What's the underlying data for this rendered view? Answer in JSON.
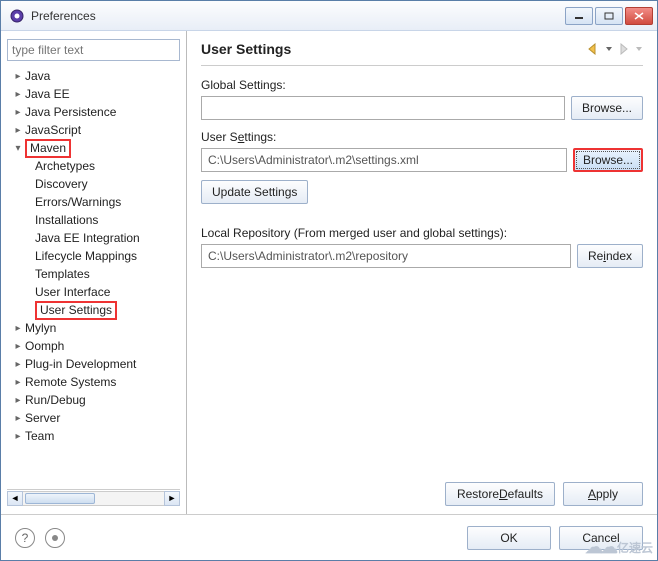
{
  "window": {
    "title": "Preferences"
  },
  "filter": {
    "placeholder": "type filter text"
  },
  "tree": {
    "items": [
      {
        "label": "Java",
        "level": 1,
        "expandable": true,
        "expanded": false
      },
      {
        "label": "Java EE",
        "level": 1,
        "expandable": true,
        "expanded": false
      },
      {
        "label": "Java Persistence",
        "level": 1,
        "expandable": true,
        "expanded": false
      },
      {
        "label": "JavaScript",
        "level": 1,
        "expandable": true,
        "expanded": false
      },
      {
        "label": "Maven",
        "level": 1,
        "expandable": true,
        "expanded": true,
        "highlight": true
      },
      {
        "label": "Archetypes",
        "level": 2,
        "expandable": false
      },
      {
        "label": "Discovery",
        "level": 2,
        "expandable": false
      },
      {
        "label": "Errors/Warnings",
        "level": 2,
        "expandable": false
      },
      {
        "label": "Installations",
        "level": 2,
        "expandable": false
      },
      {
        "label": "Java EE Integration",
        "level": 2,
        "expandable": false
      },
      {
        "label": "Lifecycle Mappings",
        "level": 2,
        "expandable": false
      },
      {
        "label": "Templates",
        "level": 2,
        "expandable": false
      },
      {
        "label": "User Interface",
        "level": 2,
        "expandable": false
      },
      {
        "label": "User Settings",
        "level": 2,
        "expandable": false,
        "highlight": true
      },
      {
        "label": "Mylyn",
        "level": 1,
        "expandable": true,
        "expanded": false
      },
      {
        "label": "Oomph",
        "level": 1,
        "expandable": true,
        "expanded": false
      },
      {
        "label": "Plug-in Development",
        "level": 1,
        "expandable": true,
        "expanded": false
      },
      {
        "label": "Remote Systems",
        "level": 1,
        "expandable": true,
        "expanded": false
      },
      {
        "label": "Run/Debug",
        "level": 1,
        "expandable": true,
        "expanded": false
      },
      {
        "label": "Server",
        "level": 1,
        "expandable": true,
        "expanded": false
      },
      {
        "label": "Team",
        "level": 1,
        "expandable": true,
        "expanded": false
      }
    ]
  },
  "page": {
    "title": "User Settings",
    "globalSettingsLabel": "Global Settings:",
    "globalSettingsValue": "",
    "browseGlobal": "Browse...",
    "userSettingsLabel_pre": "User S",
    "userSettingsLabel_u": "e",
    "userSettingsLabel_post": "ttings:",
    "userSettingsValue": "C:\\Users\\Administrator\\.m2\\settings.xml",
    "browseUser": "Browse...",
    "updateSettings": "Update Settings",
    "localRepoLabel": "Local Repository (From merged user and global settings):",
    "localRepoValue": "C:\\Users\\Administrator\\.m2\\repository",
    "reindex_pre": "Re",
    "reindex_u": "i",
    "reindex_post": "ndex",
    "restoreDefaults_pre": "Restore ",
    "restoreDefaults_u": "D",
    "restoreDefaults_post": "efaults",
    "apply_u": "A",
    "apply_post": "pply"
  },
  "footer": {
    "ok": "OK",
    "cancel": "Cancel"
  },
  "watermark": "亿速云"
}
